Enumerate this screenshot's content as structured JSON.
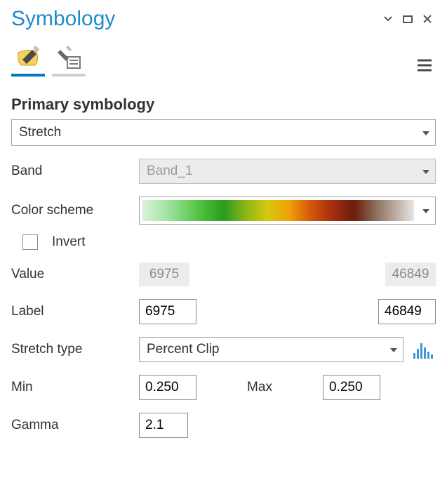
{
  "header": {
    "title": "Symbology"
  },
  "tabs": {
    "primary_icon": "brush-layer-icon",
    "secondary_icon": "brush-list-icon"
  },
  "section_title": "Primary symbology",
  "symbology_type": "Stretch",
  "form": {
    "band_label": "Band",
    "band_value": "Band_1",
    "color_scheme_label": "Color scheme",
    "invert_label": "Invert",
    "value_label": "Value",
    "value_min": "6975",
    "value_max": "46849",
    "label_label": "Label",
    "label_min": "6975",
    "label_max": "46849",
    "stretch_type_label": "Stretch type",
    "stretch_type_value": "Percent Clip",
    "min_label": "Min",
    "min_value": "0.250",
    "max_label": "Max",
    "max_value": "0.250",
    "gamma_label": "Gamma",
    "gamma_value": "2.1"
  }
}
